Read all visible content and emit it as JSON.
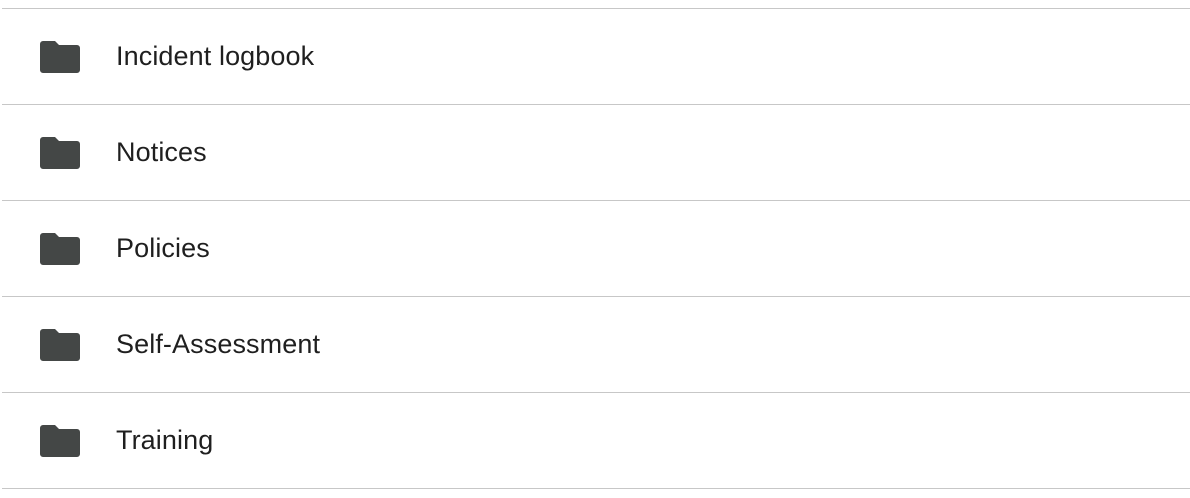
{
  "folders": [
    {
      "label": "Incident logbook",
      "icon": "folder-icon"
    },
    {
      "label": "Notices",
      "icon": "folder-icon"
    },
    {
      "label": "Policies",
      "icon": "folder-icon"
    },
    {
      "label": "Self-Assessment",
      "icon": "folder-icon"
    },
    {
      "label": "Training",
      "icon": "folder-icon"
    }
  ],
  "colors": {
    "icon": "#444746",
    "text": "#1f1f1f",
    "divider": "#c7c7c7"
  }
}
